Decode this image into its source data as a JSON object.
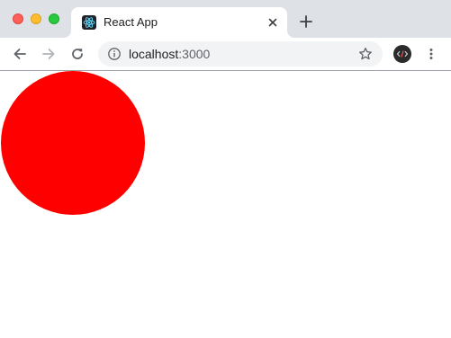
{
  "browser": {
    "tab": {
      "title": "React App",
      "favicon": "react-logo-icon",
      "close_icon": "close-icon"
    },
    "new_tab_icon": "plus-icon",
    "toolbar": {
      "back_icon": "arrow-back-icon",
      "forward_icon": "arrow-forward-icon",
      "reload_icon": "reload-icon",
      "site_info_icon": "info-icon",
      "url_host": "localhost",
      "url_port": ":3000",
      "bookmark_icon": "star-icon",
      "extension_icon": "code-extension-icon",
      "menu_icon": "more-vert-icon"
    }
  },
  "page": {
    "circle": {
      "color": "#ff0000"
    }
  },
  "colors": {
    "tabstrip_bg": "#dee1e6",
    "omnibox_bg": "#f1f3f4",
    "traffic_close": "#fe5f57",
    "traffic_minimize": "#febc2e",
    "traffic_maximize": "#28c840"
  }
}
